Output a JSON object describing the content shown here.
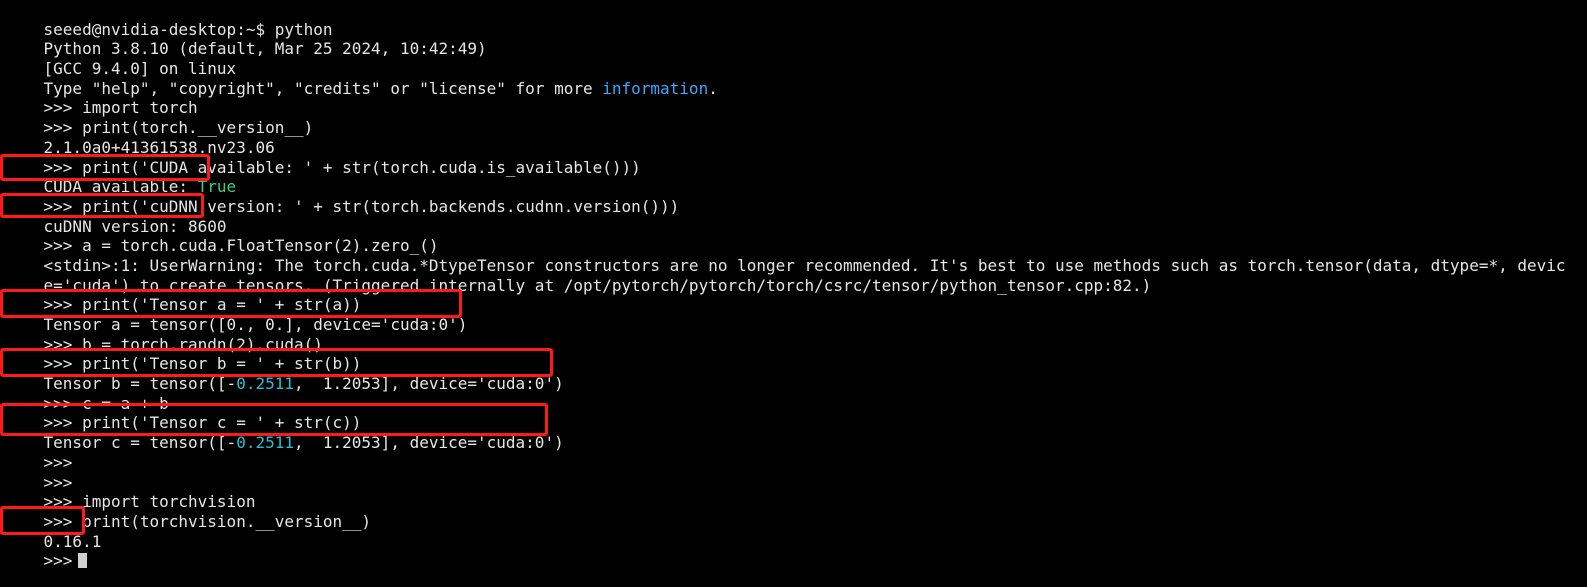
{
  "colors": {
    "background": "#000000",
    "text": "#e6e6e6",
    "keyword_blue": "#3ea6ff",
    "boolean_green": "#3fd07a",
    "number_cyan": "#22c3d6",
    "highlight_red": "#ff1a1a"
  },
  "lines": [
    {
      "segments": [
        {
          "text": "seeed@nvidia-desktop:~$ python"
        }
      ]
    },
    {
      "segments": [
        {
          "text": "Python 3.8.10 (default, Mar 25 2024, 10:42:49)"
        }
      ]
    },
    {
      "segments": [
        {
          "text": "[GCC 9.4.0] on linux"
        }
      ]
    },
    {
      "segments": [
        {
          "text": "Type \"help\", \"copyright\", \"credits\" or \"license\" for more "
        },
        {
          "text": "information",
          "style": "blue"
        },
        {
          "text": "."
        }
      ]
    },
    {
      "segments": [
        {
          "text": ">>> import torch"
        }
      ]
    },
    {
      "segments": [
        {
          "text": ">>> print(torch.__version__)"
        }
      ]
    },
    {
      "segments": [
        {
          "text": "2.1.0a0+41361538.nv23.06"
        }
      ]
    },
    {
      "segments": [
        {
          "text": ">>> print('CUDA available: ' + str(torch.cuda.is_available()))"
        }
      ]
    },
    {
      "segments": [
        {
          "text": "CUDA available: "
        },
        {
          "text": "True",
          "style": "green"
        }
      ],
      "highlight": true
    },
    {
      "segments": [
        {
          "text": ">>> print('cuDNN version: ' + str(torch.backends.cudnn.version()))"
        }
      ]
    },
    {
      "segments": [
        {
          "text": "cuDNN version: 8600"
        }
      ],
      "highlight": true
    },
    {
      "segments": [
        {
          "text": ">>> a = torch.cuda.FloatTensor(2).zero_()"
        }
      ]
    },
    {
      "segments": [
        {
          "text": "<stdin>:1: UserWarning: The torch.cuda.*DtypeTensor constructors are no longer recommended. It's best to use methods such as torch.tensor(data, dtype=*, devic"
        }
      ]
    },
    {
      "segments": [
        {
          "text": "e='cuda') to create tensors. (Triggered internally at /opt/pytorch/pytorch/torch/csrc/tensor/python_tensor.cpp:82.)"
        }
      ]
    },
    {
      "segments": [
        {
          "text": ">>> print('Tensor a = ' + str(a))"
        }
      ]
    },
    {
      "segments": [
        {
          "text": "Tensor a = tensor([0., 0.], device='cuda:0')"
        }
      ],
      "highlight": true
    },
    {
      "segments": [
        {
          "text": ">>> b = torch.randn(2).cuda()"
        }
      ]
    },
    {
      "segments": [
        {
          "text": ">>> print('Tensor b = ' + str(b))"
        }
      ]
    },
    {
      "segments": [
        {
          "text": "Tensor b = tensor([-"
        },
        {
          "text": "0.2511",
          "style": "cyan"
        },
        {
          "text": ",  1.2053], device='cuda:0')"
        }
      ],
      "highlight": true
    },
    {
      "segments": [
        {
          "text": ">>> c = a + b"
        }
      ]
    },
    {
      "segments": [
        {
          "text": ">>> print('Tensor c = ' + str(c))"
        }
      ]
    },
    {
      "segments": [
        {
          "text": "Tensor c = tensor([-"
        },
        {
          "text": "0.2511",
          "style": "cyan"
        },
        {
          "text": ",  1.2053], device='cuda:0')"
        }
      ],
      "highlight": true
    },
    {
      "segments": [
        {
          "text": ">>>"
        }
      ]
    },
    {
      "segments": [
        {
          "text": ">>>"
        }
      ]
    },
    {
      "segments": [
        {
          "text": ">>> import torchvision"
        }
      ]
    },
    {
      "segments": [
        {
          "text": ">>> print(torchvision.__version__)"
        }
      ]
    },
    {
      "segments": [
        {
          "text": "0.16.1"
        }
      ],
      "highlight": true
    },
    {
      "segments": [
        {
          "text": ">>>"
        }
      ],
      "cursor": true
    }
  ]
}
